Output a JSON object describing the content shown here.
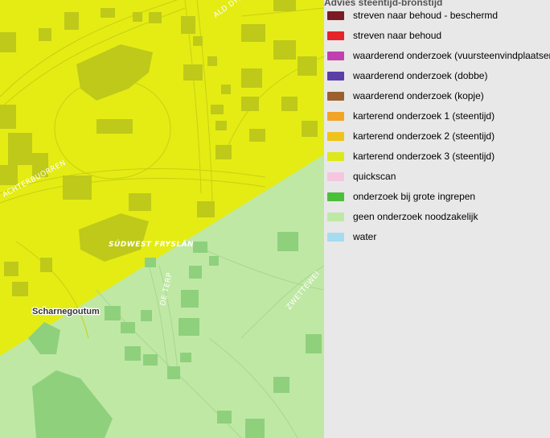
{
  "map": {
    "place_label": "Scharnegoutum",
    "region_label": "SÚDWEST FRYSLÂN",
    "streets": [
      "ACHTERBUORREN",
      "DE TERP",
      "ZWETTEWEI",
      "ALD DYK"
    ]
  },
  "legend": {
    "title": "Advies steentijd-bronstijd",
    "items": [
      {
        "label": "streven naar behoud - beschermd",
        "color": "#7b1c22"
      },
      {
        "label": "streven naar behoud",
        "color": "#e5232b"
      },
      {
        "label": "waarderend onderzoek (vuursteenvindplaatsen)",
        "color": "#c23fae"
      },
      {
        "label": "waarderend onderzoek (dobbe)",
        "color": "#5b3ea8"
      },
      {
        "label": "waarderend onderzoek (kopje)",
        "color": "#9c5f2e"
      },
      {
        "label": "karterend onderzoek 1 (steentijd)",
        "color": "#f2a427"
      },
      {
        "label": "karterend onderzoek 2 (steentijd)",
        "color": "#f0c21c"
      },
      {
        "label": "karterend onderzoek 3 (steentijd)",
        "color": "#dde81a"
      },
      {
        "label": "quickscan",
        "color": "#f5c6e0"
      },
      {
        "label": "onderzoek bij grote ingrepen",
        "color": "#4cbf3a"
      },
      {
        "label": "geen onderzoek noodzakelijk",
        "color": "#bfe8a5"
      },
      {
        "label": "water",
        "color": "#a5dcef"
      }
    ]
  }
}
